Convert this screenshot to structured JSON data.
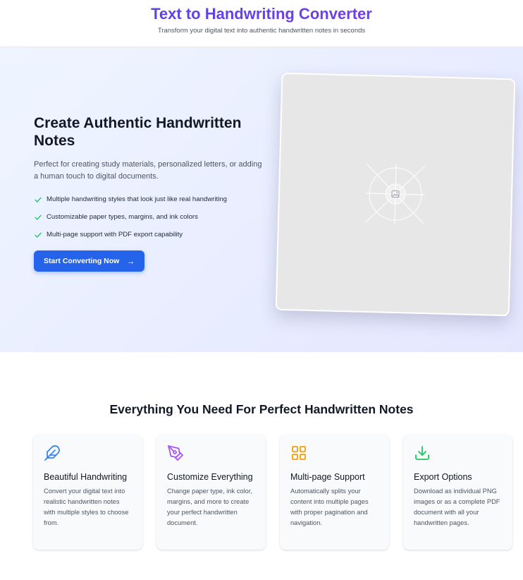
{
  "header": {
    "title": "Text to Handwriting Converter",
    "subtitle": "Transform your digital text into authentic handwritten notes in seconds"
  },
  "hero": {
    "title_line1": "Create Authentic Handwritten",
    "title_line2": "Notes",
    "description": "Perfect for creating study materials, personalized letters, or adding a human touch to digital documents.",
    "features": [
      "Multiple handwriting styles that look just like real handwriting",
      "Customizable paper types, margins, and ink colors",
      "Multi-page support with PDF export capability"
    ],
    "cta_label": "Start Converting Now",
    "cta_arrow": "→",
    "preview_icon": "image-placeholder-icon"
  },
  "features_section": {
    "title": "Everything You Need For Perfect Handwritten Notes",
    "cards": [
      {
        "title": "Beautiful Handwriting",
        "text": "Convert your digital text into realistic handwritten notes with multiple styles to choose from.",
        "icon": "feather-icon",
        "color": "#3b82f6"
      },
      {
        "title": "Customize Everything",
        "text": "Change paper type, ink color, margins, and more to create your perfect handwritten document.",
        "icon": "pen-tool-icon",
        "color": "#a855f7"
      },
      {
        "title": "Multi-page Support",
        "text": "Automatically splits your content into multiple pages with proper pagination and navigation.",
        "icon": "grid-icon",
        "color": "#f59e0b"
      },
      {
        "title": "Export Options",
        "text": "Download as individual PNG images or as a complete PDF document with all your handwritten pages.",
        "icon": "download-icon",
        "color": "#22c55e"
      }
    ]
  },
  "colors": {
    "primary": "#2563eb",
    "title_gradient_start": "#4f46e5",
    "title_gradient_end": "#7c3aed",
    "check": "#22c55e"
  }
}
